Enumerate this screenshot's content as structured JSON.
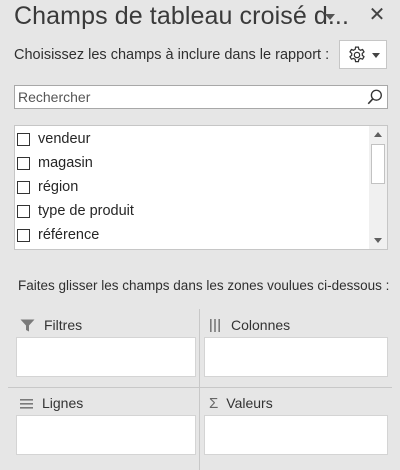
{
  "header": {
    "title": "Champs de tableau croisé d..."
  },
  "field_chooser": {
    "instruction": "Choisissez les champs à inclure dans le rapport :",
    "settings": {
      "icon": "gear-icon"
    }
  },
  "search": {
    "placeholder": "Rechercher",
    "value": ""
  },
  "fields": [
    {
      "label": "vendeur",
      "checked": false
    },
    {
      "label": "magasin",
      "checked": false
    },
    {
      "label": "région",
      "checked": false
    },
    {
      "label": "type de produit",
      "checked": false
    },
    {
      "label": "référence",
      "checked": false
    }
  ],
  "areas": {
    "instruction": "Faites glisser les champs dans les zones voulues ci-dessous :",
    "filters": {
      "label": "Filtres",
      "icon": "filter-icon"
    },
    "columns": {
      "label": "Colonnes",
      "icon": "columns-icon"
    },
    "rows": {
      "label": "Lignes",
      "icon": "rows-icon"
    },
    "values": {
      "label": "Valeurs",
      "icon": "sigma-icon"
    }
  }
}
